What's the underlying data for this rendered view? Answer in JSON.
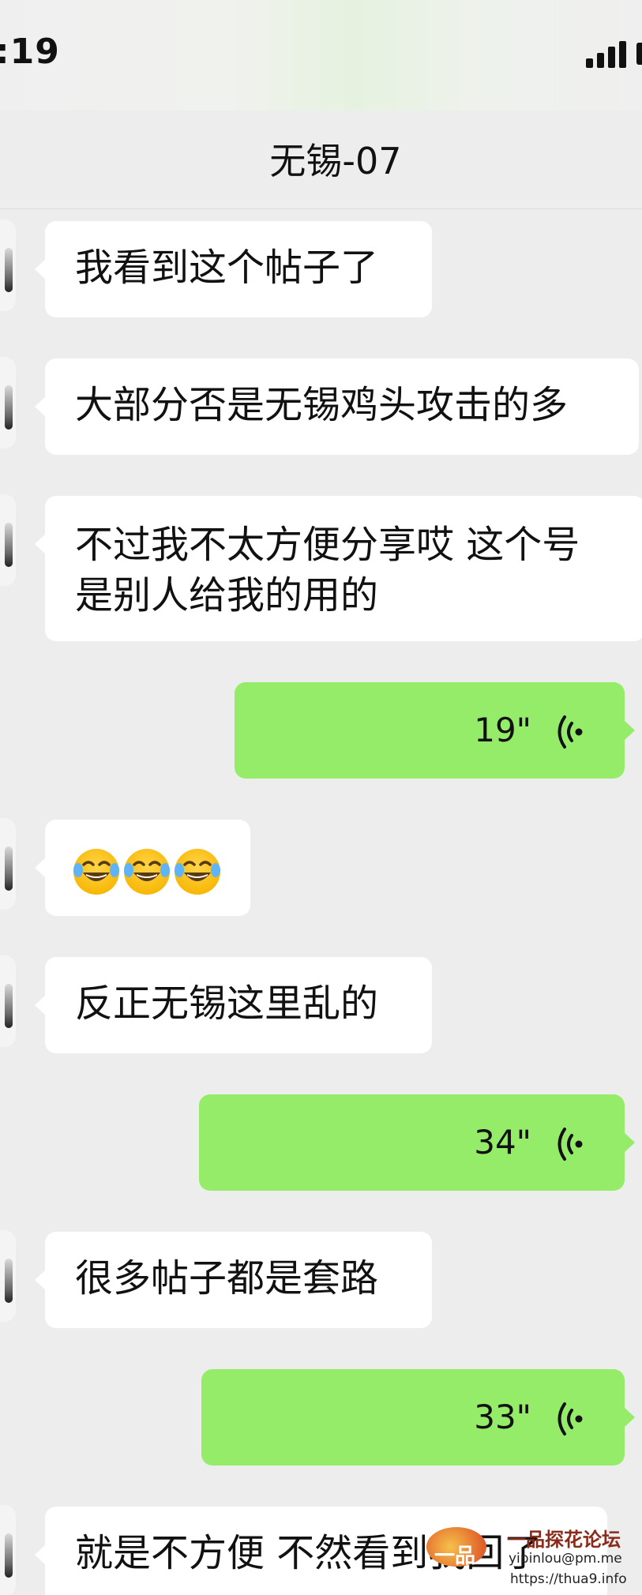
{
  "status_bar": {
    "time": ":19"
  },
  "nav": {
    "title": "无锡-07"
  },
  "messages": [
    {
      "side": "left",
      "type": "text",
      "text": "我看到这个帖子了"
    },
    {
      "side": "left",
      "type": "text",
      "text": "大部分否是无锡鸡头攻击的多"
    },
    {
      "side": "left",
      "type": "text",
      "lines": [
        "不过我不太方便分享哎 这个号",
        "是别人给我的用的"
      ]
    },
    {
      "side": "right",
      "type": "voice",
      "duration": "19\""
    },
    {
      "side": "left",
      "type": "emoji",
      "emoji": "tears-of-joy-icon",
      "count": 3
    },
    {
      "side": "left",
      "type": "text",
      "text": "反正无锡这里乱的"
    },
    {
      "side": "right",
      "type": "voice",
      "duration": "34\""
    },
    {
      "side": "left",
      "type": "text",
      "text": "很多帖子都是套路"
    },
    {
      "side": "right",
      "type": "voice",
      "duration": "33\""
    },
    {
      "side": "left",
      "type": "text",
      "text": "就是不方便 不然看到我回了"
    }
  ],
  "watermark": {
    "logo_text": "一品楼",
    "name": "一品探花论坛",
    "email": "yipinlou@pm.me",
    "url": "https://thua9.info"
  },
  "colors": {
    "background": "#ededed",
    "incoming_bubble": "#ffffff",
    "outgoing_bubble": "#95ec69",
    "text": "#111111"
  }
}
